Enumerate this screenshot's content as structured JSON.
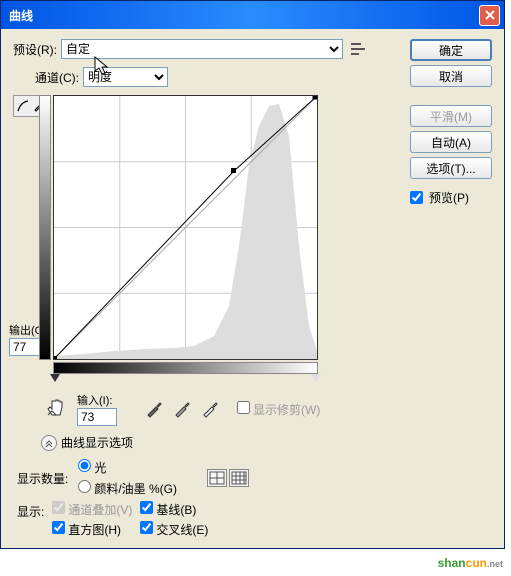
{
  "titlebar": {
    "title": "曲线",
    "close": "X"
  },
  "preset": {
    "label": "预设(R):",
    "value": "自定"
  },
  "channel": {
    "label": "通道(C):",
    "value": "明度"
  },
  "io": {
    "output_label": "输出(O):",
    "output_value": "77",
    "input_label": "输入(I):",
    "input_value": "73"
  },
  "show_clipping": {
    "label": "显示修剪(W)",
    "checked": false
  },
  "expand": {
    "label": "曲线显示选项"
  },
  "display_amount": {
    "label": "显示数量:",
    "opt_light": "光",
    "opt_pigment": "颜料/油墨 %(G)"
  },
  "show": {
    "label": "显示:",
    "channel_overlay": "通道叠加(V)",
    "baseline": "基线(B)",
    "histogram": "直方图(H)",
    "intersection": "交叉线(E)"
  },
  "buttons": {
    "ok": "确定",
    "cancel": "取消",
    "smooth": "平滑(M)",
    "auto": "自动(A)",
    "options": "选项(T)...",
    "preview": "预览(P)"
  },
  "preview_checked": true,
  "curve": {
    "point_input": 73,
    "point_output": 77,
    "grid_divisions": 4
  }
}
